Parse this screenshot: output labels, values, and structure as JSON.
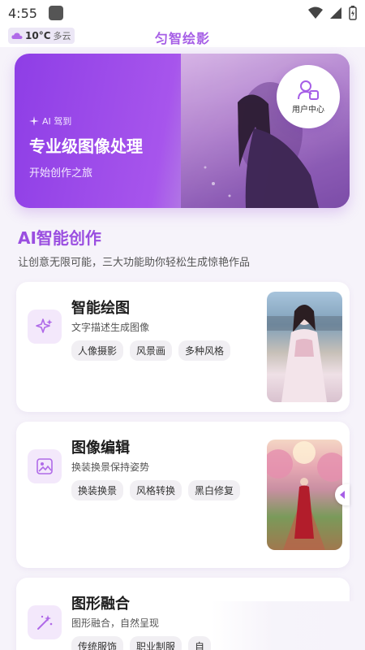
{
  "status_bar": {
    "time": "4:55"
  },
  "header": {
    "weather_temp": "10°C",
    "weather_condition": "多云",
    "app_title": "匀智绘影"
  },
  "banner": {
    "tag": "AI 驾到",
    "title": "专业级图像处理",
    "subtitle": "开始创作之旅",
    "user_center_label": "用户中心"
  },
  "section": {
    "title": "AI智能创作",
    "subtitle": "让创意无限可能，三大功能助你轻松生成惊艳作品"
  },
  "cards": [
    {
      "title": "智能绘图",
      "description": "文字描述生成图像",
      "tags": [
        "人像摄影",
        "风景画",
        "多种风格"
      ],
      "icon": "sparkle-icon"
    },
    {
      "title": "图像编辑",
      "description": "换装换景保持姿势",
      "tags": [
        "换装换景",
        "风格转换",
        "黑白修复"
      ],
      "icon": "image-icon"
    },
    {
      "title": "图形融合",
      "description": "图形融合，自然呈现",
      "tags": [
        "传统服饰",
        "职业制服",
        "自"
      ],
      "icon": "magic-wand-icon"
    }
  ],
  "colors": {
    "accent": "#a65ee6",
    "banner_start": "#8e3ee6",
    "icon_bg": "#f3e8fb"
  }
}
